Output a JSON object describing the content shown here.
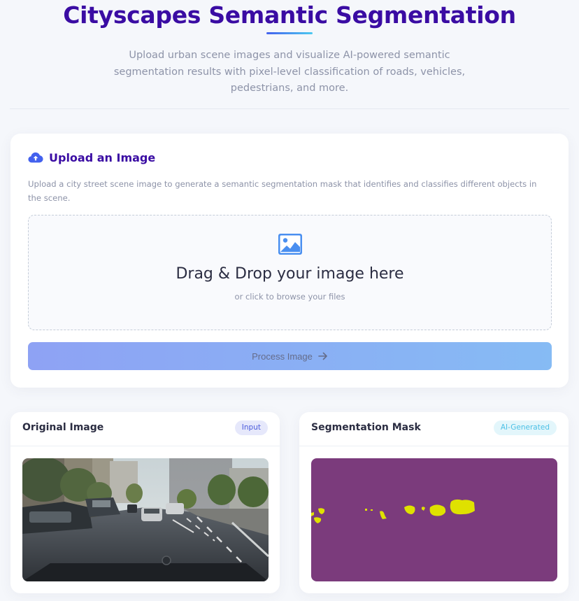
{
  "header": {
    "title": "Cityscapes Semantic Segmentation",
    "subtitle": "Upload urban scene images and visualize AI-powered semantic segmentation results with pixel-level classification of roads, vehicles, pedestrians, and more."
  },
  "upload": {
    "icon": "cloud-upload-icon",
    "title": "Upload an Image",
    "description": "Upload a city street scene image to generate a semantic segmentation mask that identifies and classifies different objects in the scene.",
    "dropzone": {
      "icon": "image-icon",
      "title": "Drag & Drop your image here",
      "subtitle": "or click to browse your files"
    },
    "process_button": {
      "label": "Process Image",
      "icon": "arrow-right-icon"
    }
  },
  "results": {
    "original": {
      "title": "Original Image",
      "badge": "Input"
    },
    "mask": {
      "title": "Segmentation Mask",
      "badge": "AI-Generated"
    }
  },
  "colors": {
    "brand": "#3a0ca3",
    "accent": "#4361ee",
    "mask_background": "#7b3b7c",
    "mask_segment": "#dfe100"
  }
}
